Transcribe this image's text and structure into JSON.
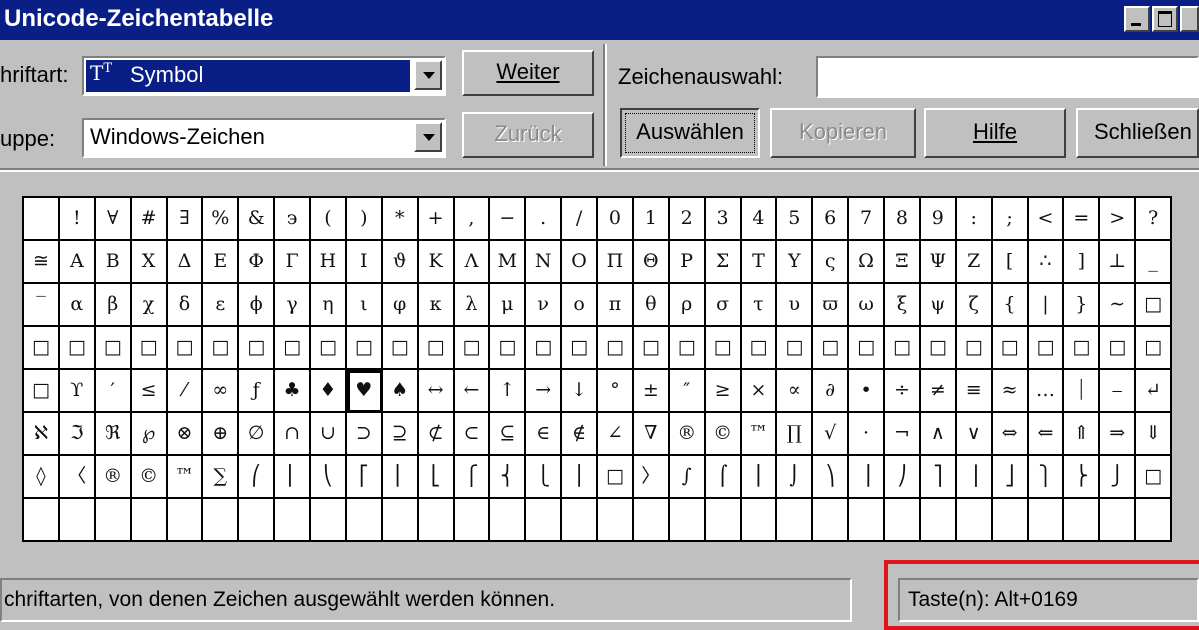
{
  "window": {
    "title": "Unicode-Zeichentabelle"
  },
  "toolbar": {
    "font_label": "hriftart:",
    "font_icon": "truetype-font-icon",
    "font_value": "Symbol",
    "group_label": "uppe:",
    "group_value": "Windows-Zeichen",
    "next_label": "Weiter",
    "back_label": "Zurück",
    "selection_label": "Zeichenauswahl:",
    "selection_value": "",
    "select_label": "Auswählen",
    "copy_label": "Kopieren",
    "help_label": "Hilfe",
    "close_label": "Schließen"
  },
  "grid": {
    "rows": [
      [
        "",
        "!",
        "∀",
        "#",
        "∃",
        "%",
        "&",
        "϶",
        "(",
        ")",
        "*",
        "+",
        ",",
        "−",
        ".",
        "/",
        "0",
        "1",
        "2",
        "3",
        "4",
        "5",
        "6",
        "7",
        "8",
        "9",
        ":",
        ";",
        "<",
        "=",
        ">",
        "?"
      ],
      [
        "≅",
        "Α",
        "Β",
        "Χ",
        "Δ",
        "Ε",
        "Φ",
        "Γ",
        "Η",
        "Ι",
        "ϑ",
        "Κ",
        "Λ",
        "Μ",
        "Ν",
        "Ο",
        "Π",
        "Θ",
        "Ρ",
        "Σ",
        "Τ",
        "Υ",
        "ς",
        "Ω",
        "Ξ",
        "Ψ",
        "Ζ",
        "[",
        "∴",
        "]",
        "⊥",
        "_"
      ],
      [
        "‾",
        "α",
        "β",
        "χ",
        "δ",
        "ε",
        "ϕ",
        "γ",
        "η",
        "ι",
        "φ",
        "κ",
        "λ",
        "μ",
        "ν",
        "ο",
        "π",
        "θ",
        "ρ",
        "σ",
        "τ",
        "υ",
        "ϖ",
        "ω",
        "ξ",
        "ψ",
        "ζ",
        "{",
        "|",
        "}",
        "∼",
        "□"
      ],
      [
        "□",
        "□",
        "□",
        "□",
        "□",
        "□",
        "□",
        "□",
        "□",
        "□",
        "□",
        "□",
        "□",
        "□",
        "□",
        "□",
        "□",
        "□",
        "□",
        "□",
        "□",
        "□",
        "□",
        "□",
        "□",
        "□",
        "□",
        "□",
        "□",
        "□",
        "□",
        "□"
      ],
      [
        "□",
        "ϒ",
        "′",
        "≤",
        "⁄",
        "∞",
        "ƒ",
        "♣",
        "♦",
        "♥",
        "♠",
        "↔",
        "←",
        "↑",
        "→",
        "↓",
        "°",
        "±",
        "″",
        "≥",
        "×",
        "∝",
        "∂",
        "•",
        "÷",
        "≠",
        "≡",
        "≈",
        "…",
        "⏐",
        "⎯",
        "↵"
      ],
      [
        "ℵ",
        "ℑ",
        "ℜ",
        "℘",
        "⊗",
        "⊕",
        "∅",
        "∩",
        "∪",
        "⊃",
        "⊇",
        "⊄",
        "⊂",
        "⊆",
        "∈",
        "∉",
        "∠",
        "∇",
        "®",
        "©",
        "™",
        "∏",
        "√",
        "⋅",
        "¬",
        "∧",
        "∨",
        "⇔",
        "⇐",
        "⇑",
        "⇒",
        "⇓"
      ],
      [
        "◊",
        "〈",
        "®",
        "©",
        "™",
        "∑",
        "⎛",
        "⎜",
        "⎝",
        "⎡",
        "⎢",
        "⎣",
        "⎧",
        "⎨",
        "⎩",
        "⎪",
        "□",
        "〉",
        "∫",
        "⌠",
        "⎮",
        "⌡",
        "⎞",
        "⎟",
        "⎠",
        "⎤",
        "⎥",
        "⎦",
        "⎫",
        "⎬",
        "⎭",
        "□"
      ],
      [
        "",
        "",
        "",
        "",
        "",
        "",
        "",
        "",
        "",
        "",
        "",
        "",
        "",
        "",
        "",
        "",
        "",
        "",
        "",
        "",
        "",
        "",
        "",
        "",
        "",
        "",
        "",
        "",
        "",
        "",
        "",
        ""
      ]
    ],
    "selected_row": 4,
    "selected_col": 9
  },
  "statusbar": {
    "description": "chriftarten, von denen Zeichen ausgewählt werden können.",
    "keystroke": "Taste(n): Alt+0169"
  },
  "colors": {
    "titlebar": "#0a1f86",
    "highlight_box": "#e0141e",
    "window_face": "#c0c0c0"
  }
}
